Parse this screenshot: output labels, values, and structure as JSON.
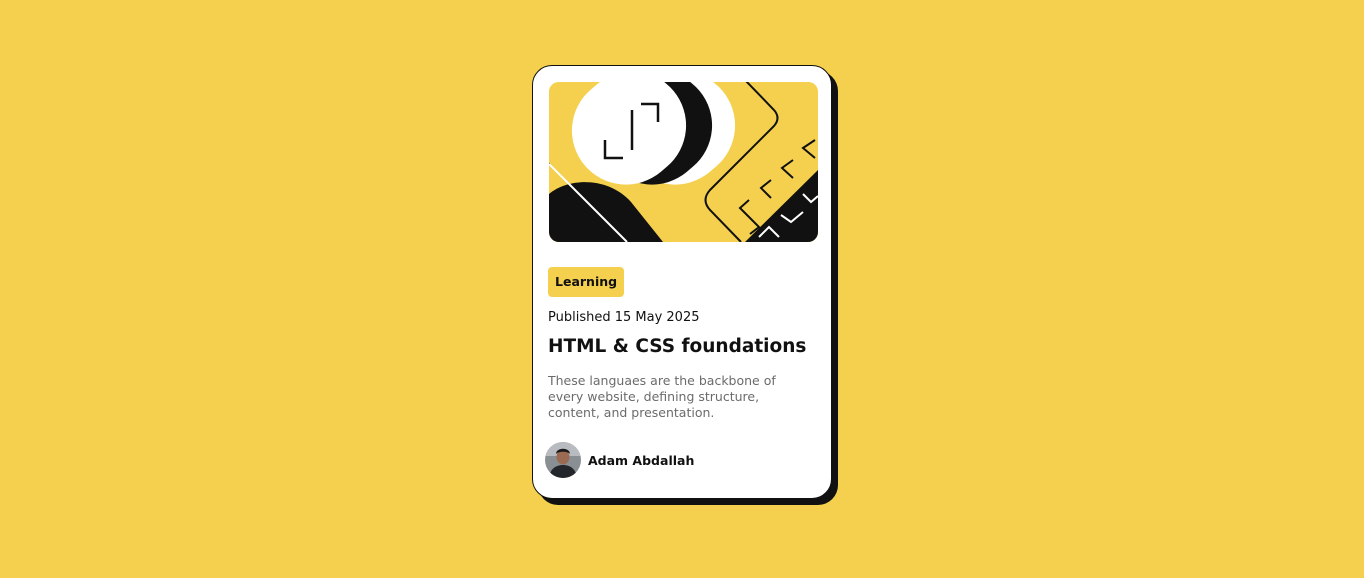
{
  "colors": {
    "background": "#f4d04e",
    "card": "#ffffff",
    "ink": "#111111",
    "muted_text": "#6b6b6b"
  },
  "card": {
    "illustration": "abstract-blog-illustration",
    "tag": "Learning",
    "published": "Published 15 May 2025",
    "title": "HTML & CSS foundations",
    "description": "These languaes are the backbone of every website, defining structure, content, and presentation.",
    "author": {
      "avatar": "author-avatar-photo",
      "name": "Adam Abdallah"
    }
  }
}
